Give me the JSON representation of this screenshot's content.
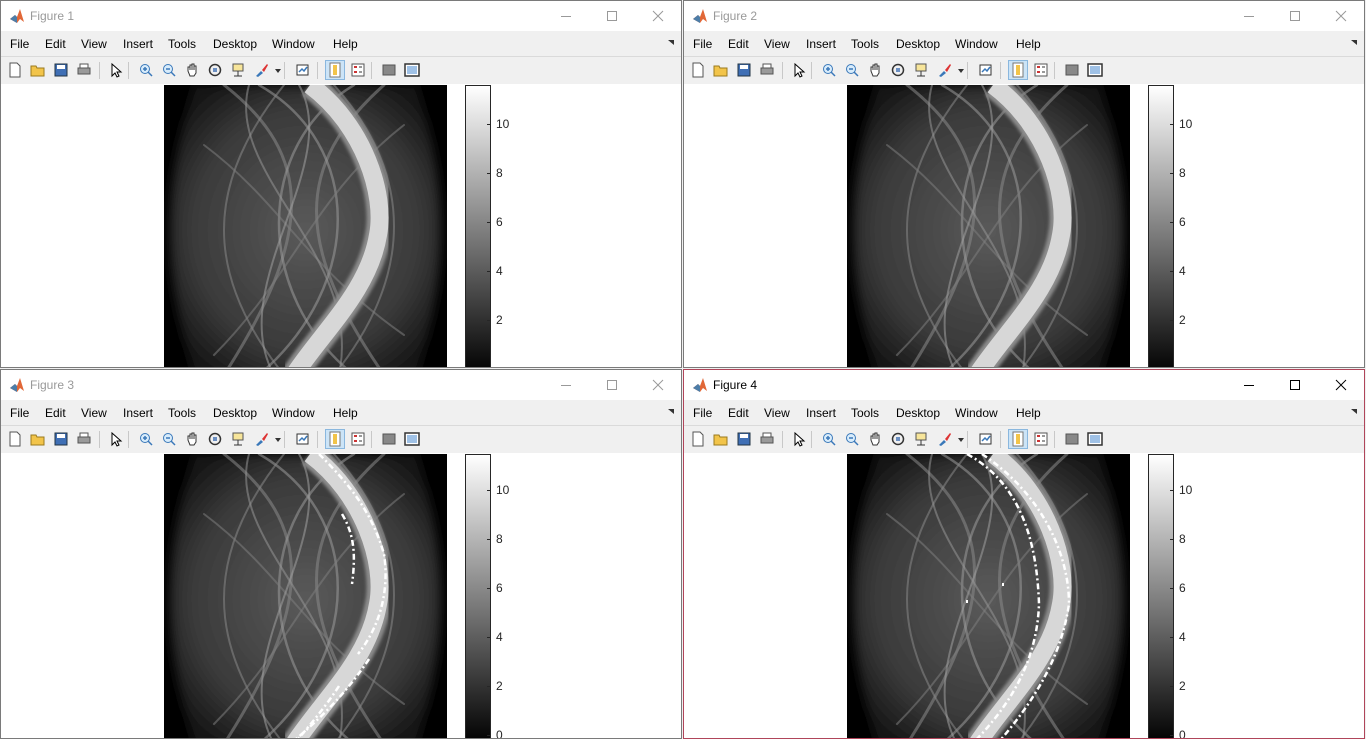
{
  "figures": [
    {
      "title": "Figure 1",
      "menu": [
        "File",
        "Edit",
        "View",
        "Insert",
        "Tools",
        "Desktop",
        "Window",
        "Help"
      ],
      "colorbar_ticks": [
        "10",
        "8",
        "6",
        "4",
        "2"
      ]
    },
    {
      "title": "Figure 2",
      "menu": [
        "File",
        "Edit",
        "View",
        "Insert",
        "Tools",
        "Desktop",
        "Window",
        "Help"
      ],
      "colorbar_ticks": [
        "10",
        "8",
        "6",
        "4",
        "2"
      ]
    },
    {
      "title": "Figure 3",
      "menu": [
        "File",
        "Edit",
        "View",
        "Insert",
        "Tools",
        "Desktop",
        "Window",
        "Help"
      ],
      "colorbar_ticks": [
        "10",
        "8",
        "6",
        "4",
        "2",
        "0"
      ]
    },
    {
      "title": "Figure 4",
      "menu": [
        "File",
        "Edit",
        "View",
        "Insert",
        "Tools",
        "Desktop",
        "Window",
        "Help"
      ],
      "colorbar_ticks": [
        "10",
        "8",
        "6",
        "4",
        "2",
        "0"
      ]
    }
  ],
  "colors": {
    "accent": "#0072bd",
    "active_border": "#b0455a",
    "overlay_markers": "#ffffff"
  },
  "toolbar_icons": [
    "new-figure-icon",
    "open-file-icon",
    "save-icon",
    "print-icon",
    "edit-plot-icon",
    "zoom-in-icon",
    "zoom-out-icon",
    "pan-icon",
    "rotate-3d-icon",
    "data-cursor-icon",
    "brush-icon",
    "link-plot-icon",
    "insert-colorbar-icon",
    "insert-legend-icon",
    "hide-plot-tools-icon",
    "show-plot-tools-icon"
  ]
}
